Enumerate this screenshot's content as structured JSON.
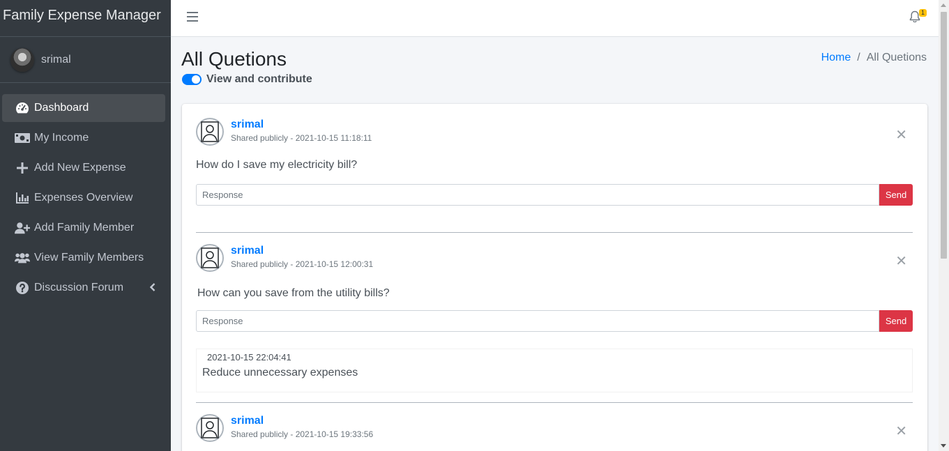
{
  "app": {
    "title": "Family Expense Manager"
  },
  "user": {
    "name": "srimal"
  },
  "sidebar": {
    "items": [
      {
        "label": "Dashboard",
        "icon": "tachometer-icon",
        "active": true
      },
      {
        "label": "My Income",
        "icon": "money-bill-icon"
      },
      {
        "label": "Add New Expense",
        "icon": "plus-icon"
      },
      {
        "label": "Expenses Overview",
        "icon": "bar-chart-icon"
      },
      {
        "label": "Add Family Member",
        "icon": "user-plus-icon"
      },
      {
        "label": "View Family Members",
        "icon": "users-icon"
      },
      {
        "label": "Discussion Forum",
        "icon": "question-circle-icon",
        "has_arrow": true
      }
    ]
  },
  "topbar": {
    "notification_count": "1"
  },
  "header": {
    "title": "All Quetions",
    "toggle_label": "View and contribute",
    "toggle_on": true,
    "breadcrumb": {
      "home": "Home",
      "separator": "/",
      "current": "All Quetions"
    }
  },
  "posts": [
    {
      "user": "srimal",
      "meta": "Shared publicly - 2021-10-15 11:18:11",
      "question": "How do I save my electricity bill?",
      "response_placeholder": "Response",
      "send_label": "Send"
    },
    {
      "user": "srimal",
      "meta": "Shared publicly - 2021-10-15 12:00:31",
      "question": "How can you save from the utility bills?",
      "response_placeholder": "Response",
      "send_label": "Send",
      "replies": [
        {
          "time": "2021-10-15 22:04:41",
          "text": "Reduce unnecessary expenses"
        }
      ]
    },
    {
      "user": "srimal",
      "meta": "Shared publicly - 2021-10-15 19:33:56"
    }
  ],
  "colors": {
    "sidebar_bg": "#343a40",
    "accent": "#007bff",
    "send_button": "#dc3545",
    "badge": "#ffc107"
  }
}
